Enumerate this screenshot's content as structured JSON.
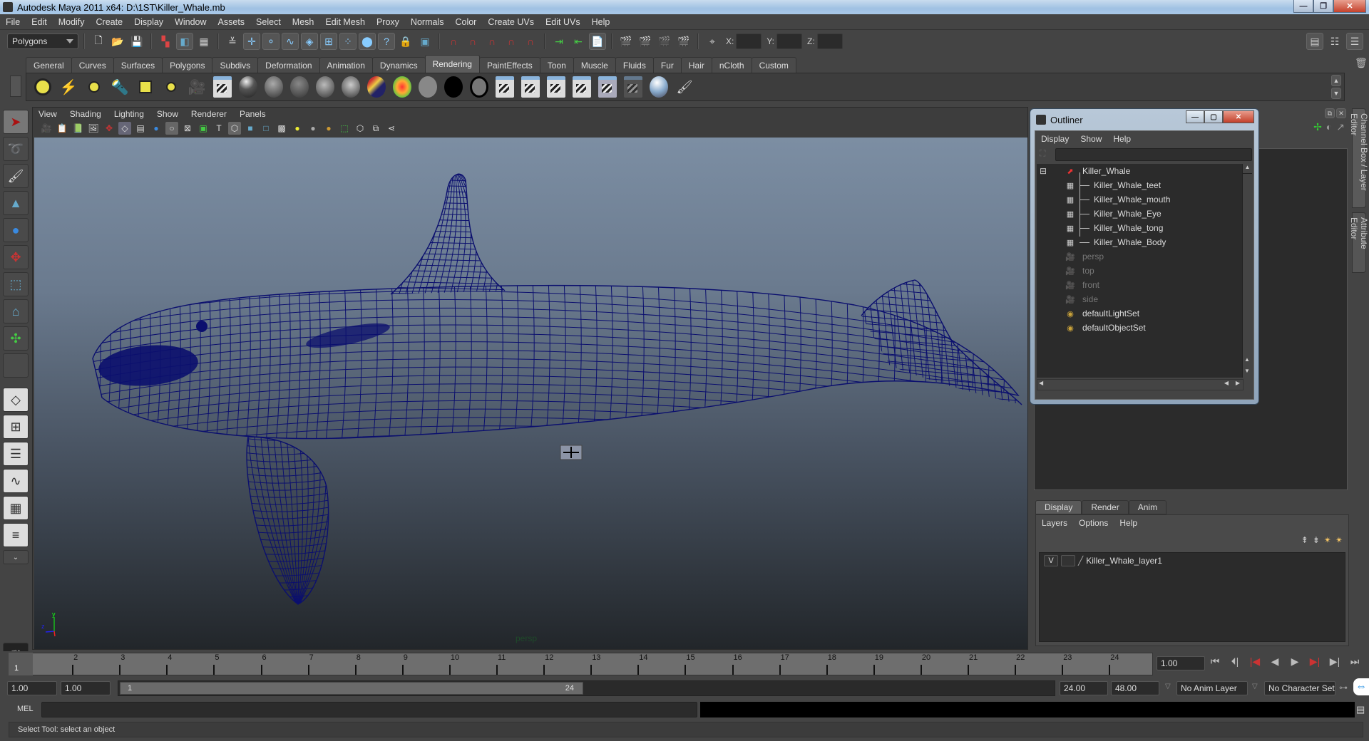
{
  "window": {
    "title": "Autodesk Maya 2011 x64: D:\\1ST\\Killer_Whale.mb",
    "controls": {
      "minimize": "—",
      "maximize": "❐",
      "close": "✕"
    }
  },
  "menubar": [
    "File",
    "Edit",
    "Modify",
    "Create",
    "Display",
    "Window",
    "Assets",
    "Select",
    "Mesh",
    "Edit Mesh",
    "Proxy",
    "Normals",
    "Color",
    "Create UVs",
    "Edit UVs",
    "Help"
  ],
  "statusline": {
    "menuset": "Polygons",
    "icons": [
      "new-scene",
      "open-scene",
      "save-scene",
      "select-by-hierarchy",
      "select-by-object-type",
      "select-by-component-type",
      "lock-selection",
      "snap-to-grid",
      "snap-to-curve",
      "snap-to-point",
      "snap-to-view-plane",
      "make-live",
      "input-ops",
      "output-ops",
      "construction-history",
      "render-view",
      "render-current-frame",
      "ipr-render",
      "render-settings"
    ],
    "coord_labels": {
      "x": "X:",
      "y": "Y:",
      "z": "Z:"
    },
    "coord_values": {
      "x": "",
      "y": "",
      "z": ""
    }
  },
  "shelf": {
    "tabs": [
      "General",
      "Curves",
      "Surfaces",
      "Polygons",
      "Subdivs",
      "Deformation",
      "Animation",
      "Dynamics",
      "Rendering",
      "PaintEffects",
      "Toon",
      "Muscle",
      "Fluids",
      "Fur",
      "Hair",
      "nCloth",
      "Custom"
    ],
    "active_tab": "Rendering"
  },
  "viewport": {
    "menus": [
      "View",
      "Shading",
      "Lighting",
      "Show",
      "Renderer",
      "Panels"
    ],
    "camera_label": "persp",
    "axis": {
      "y": "y",
      "z": "z",
      "x": "x"
    },
    "wire_color": "#0b0f6e"
  },
  "outliner": {
    "title": "Outliner",
    "menus": [
      "Display",
      "Show",
      "Help"
    ],
    "filter_value": "",
    "items": [
      {
        "label": "Killer_Whale",
        "icon": "transform-icon",
        "depth": 0,
        "dim": false,
        "expanded": true
      },
      {
        "label": "Killer_Whale_teet",
        "icon": "mesh-icon",
        "depth": 1,
        "dim": false
      },
      {
        "label": "Killer_Whale_mouth",
        "icon": "mesh-icon",
        "depth": 1,
        "dim": false
      },
      {
        "label": "Killer_Whale_Eye",
        "icon": "mesh-icon",
        "depth": 1,
        "dim": false
      },
      {
        "label": "Killer_Whale_tong",
        "icon": "mesh-icon",
        "depth": 1,
        "dim": false
      },
      {
        "label": "Killer_Whale_Body",
        "icon": "mesh-icon",
        "depth": 1,
        "dim": false
      },
      {
        "label": "persp",
        "icon": "camera-icon",
        "depth": 0,
        "dim": true
      },
      {
        "label": "top",
        "icon": "camera-icon",
        "depth": 0,
        "dim": true
      },
      {
        "label": "front",
        "icon": "camera-icon",
        "depth": 0,
        "dim": true
      },
      {
        "label": "side",
        "icon": "camera-icon",
        "depth": 0,
        "dim": true
      },
      {
        "label": "defaultLightSet",
        "icon": "set-icon",
        "depth": 0,
        "dim": false
      },
      {
        "label": "defaultObjectSet",
        "icon": "set-icon",
        "depth": 0,
        "dim": false
      }
    ]
  },
  "side_tabs": [
    "Channel Box / Layer Editor",
    "Attribute Editor"
  ],
  "layer_editor": {
    "tabs": [
      "Display",
      "Render",
      "Anim"
    ],
    "active_tab": "Display",
    "menus": [
      "Layers",
      "Options",
      "Help"
    ],
    "layers": [
      {
        "visible": "V",
        "type": "",
        "name": "Killer_Whale_layer1"
      }
    ]
  },
  "timeline": {
    "ticks": [
      "1",
      "2",
      "3",
      "4",
      "5",
      "6",
      "7",
      "8",
      "9",
      "10",
      "11",
      "12",
      "13",
      "14",
      "15",
      "16",
      "17",
      "18",
      "19",
      "20",
      "21",
      "22",
      "23",
      "24"
    ],
    "current_frame": "1",
    "current_time": "1.00",
    "playback_buttons": [
      "go-to-start",
      "step-back-key",
      "step-back-frame",
      "play-backwards",
      "play-forwards",
      "step-forward-frame",
      "step-forward-key",
      "go-to-end"
    ]
  },
  "range": {
    "start_time": "1.00",
    "playback_start": "1.00",
    "slider_start": "1",
    "slider_end": "24",
    "playback_end": "24.00",
    "end_time": "48.00",
    "anim_layer": "No Anim Layer",
    "character_set": "No Character Set"
  },
  "command_line": {
    "label": "MEL",
    "value": ""
  },
  "help_line": "Select Tool: select an object"
}
